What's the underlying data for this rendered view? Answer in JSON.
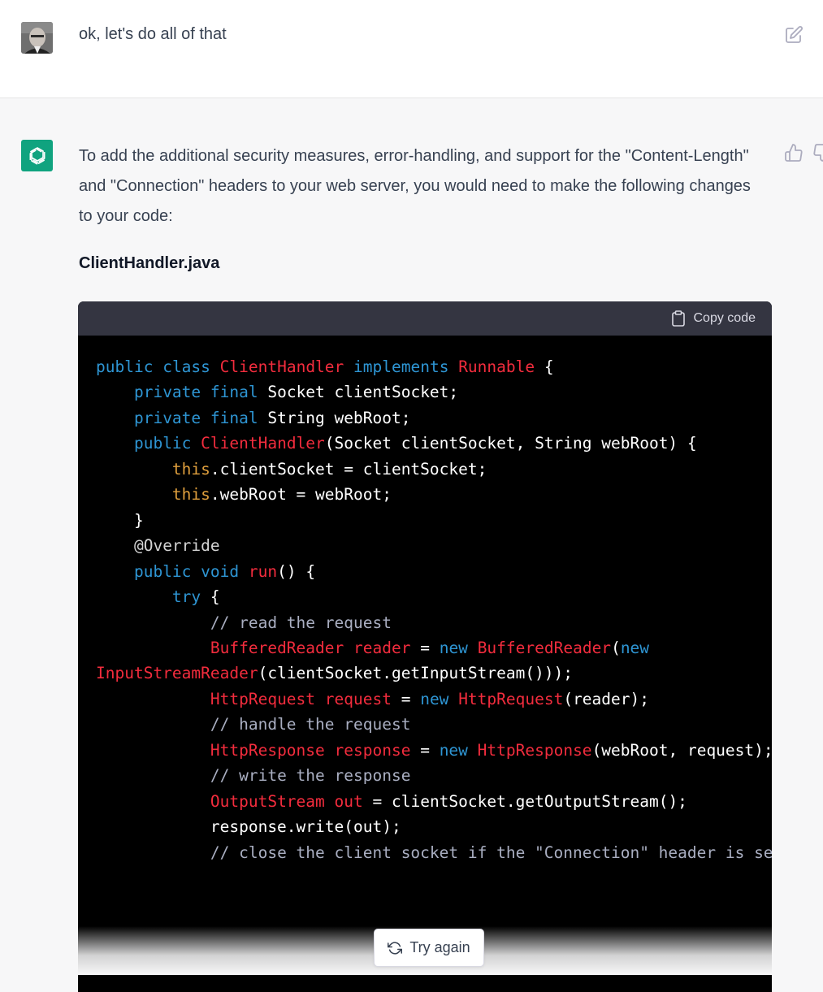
{
  "user": {
    "message": "ok, let's do all of that",
    "edit_icon": "edit-icon"
  },
  "assistant": {
    "logo_icon": "openai-logo-icon",
    "intro": "To add the additional security measures, error-handling, and support for the \"Content-Length\" and \"Connection\" headers to your web server, you would need to make the following changes to your code:",
    "file_title": "ClientHandler.java",
    "feedback_icons": [
      "thumbs-up-icon",
      "thumbs-down-icon"
    ]
  },
  "code_block": {
    "copy_label": "Copy code",
    "language": "java",
    "lines": [
      "public class ClientHandler implements Runnable {",
      "    private final Socket clientSocket;",
      "    private final String webRoot;",
      "",
      "    public ClientHandler(Socket clientSocket, String webRoot) {",
      "        this.clientSocket = clientSocket;",
      "        this.webRoot = webRoot;",
      "    }",
      "",
      "    @Override",
      "    public void run() {",
      "        try {",
      "            // read the request",
      "            BufferedReader reader = new BufferedReader(new",
      "InputStreamReader(clientSocket.getInputStream()));",
      "            HttpRequest request = new HttpRequest(reader);",
      "",
      "            // handle the request",
      "            HttpResponse response = new HttpResponse(webRoot, request);",
      "",
      "            // write the response",
      "            OutputStream out = clientSocket.getOutputStream();",
      "            response.write(out);",
      "",
      "            // close the client socket if the \"Connection\" header is set"
    ]
  },
  "actions": {
    "try_again_label": "Try again"
  },
  "colors": {
    "keyword": "#2e95d3",
    "class_name": "#f22c3d",
    "this": "#df9f3d",
    "comment": "#a9aec1",
    "accent": "#10a37f"
  }
}
